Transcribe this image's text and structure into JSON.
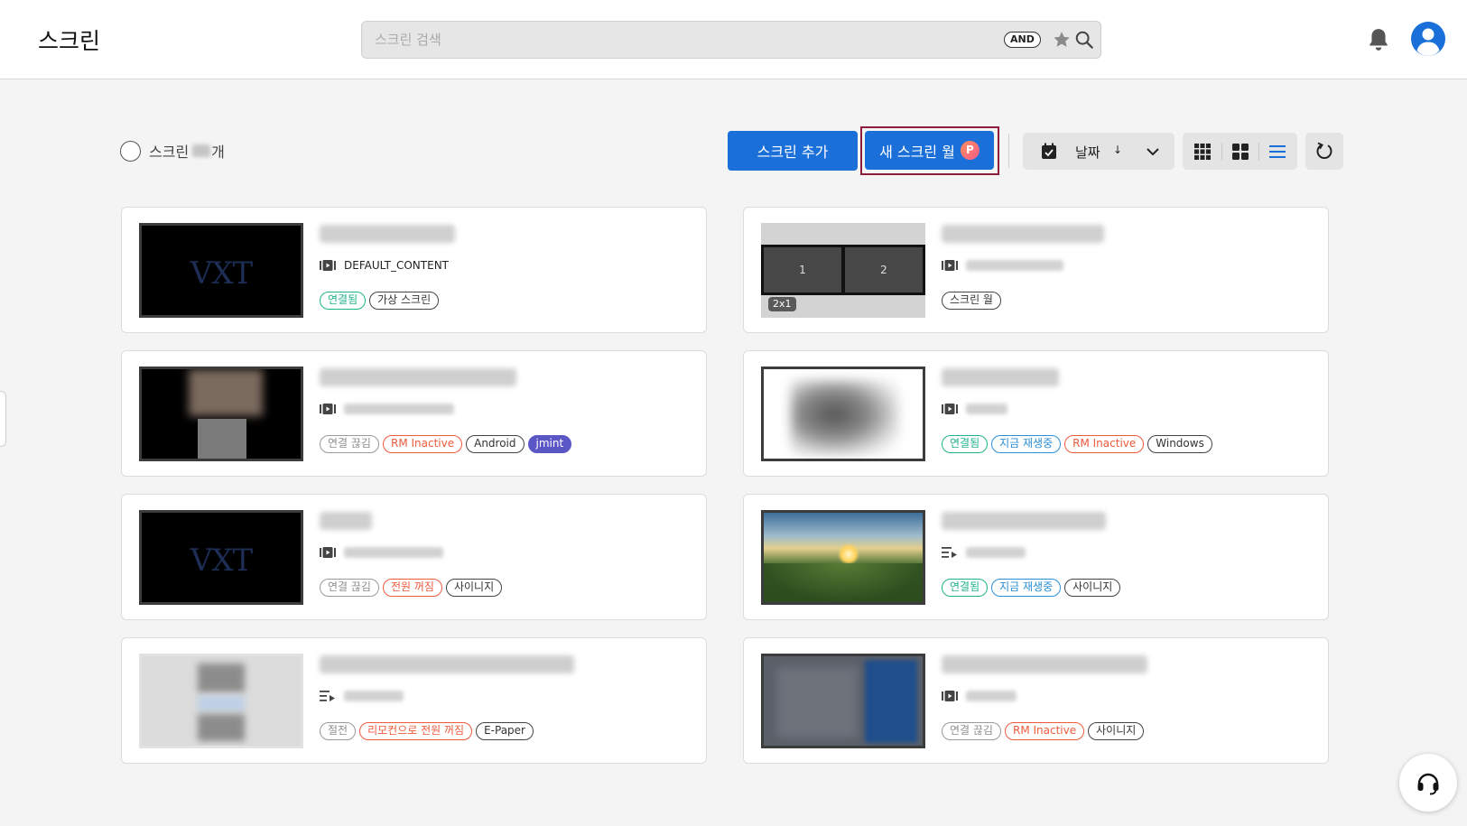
{
  "header": {
    "title": "스크린",
    "search": {
      "placeholder": "스크린 검색",
      "value": "",
      "operator_badge": "AND"
    },
    "icons": [
      "star-icon",
      "search-icon",
      "bell-icon",
      "user-avatar-icon"
    ]
  },
  "toolbar": {
    "count_prefix": "스크린",
    "count_suffix": "개",
    "add_label": "스크린 추가",
    "new_wall_label": "새 스크린 월",
    "new_wall_badge": "P",
    "sort_label": "날짜",
    "sort_direction": "↓"
  },
  "cards": [
    {
      "content": "DEFAULT_CONTENT",
      "tags": [
        {
          "label": "연결됨"
        },
        {
          "label": "가상 스크린"
        }
      ]
    },
    {
      "wall_cells": [
        "1",
        "2"
      ],
      "wall_size": "2x1",
      "tags": [
        {
          "label": "스크린 월"
        }
      ]
    },
    {
      "tags": [
        {
          "label": "연결 끊김"
        },
        {
          "label": "RM Inactive"
        },
        {
          "label": "Android"
        },
        {
          "label": "jmint"
        }
      ]
    },
    {
      "tags": [
        {
          "label": "연결됨"
        },
        {
          "label": "지금 재생중"
        },
        {
          "label": "RM Inactive"
        },
        {
          "label": "Windows"
        }
      ]
    },
    {
      "tags": [
        {
          "label": "연결 끊김"
        },
        {
          "label": "전원 꺼짐"
        },
        {
          "label": "사이니지"
        }
      ]
    },
    {
      "tags": [
        {
          "label": "연결됨"
        },
        {
          "label": "지금 재생중"
        },
        {
          "label": "사이니지"
        }
      ]
    },
    {
      "tags": [
        {
          "label": "절전"
        },
        {
          "label": "리모컨으로 전원 꺼짐"
        },
        {
          "label": "E-Paper"
        }
      ]
    },
    {
      "tags": [
        {
          "label": "연결 끊김"
        },
        {
          "label": "RM Inactive"
        },
        {
          "label": "사이니지"
        }
      ]
    }
  ],
  "colors": {
    "primary": "#1b6fd9",
    "highlight_border": "#8c1c3c",
    "status_connected": "#21b38a",
    "status_disconnected": "#8e8e8e",
    "status_warning": "#ee5a3c",
    "status_playing": "#2b8fd6",
    "tag_accent": "#5a56c6"
  }
}
